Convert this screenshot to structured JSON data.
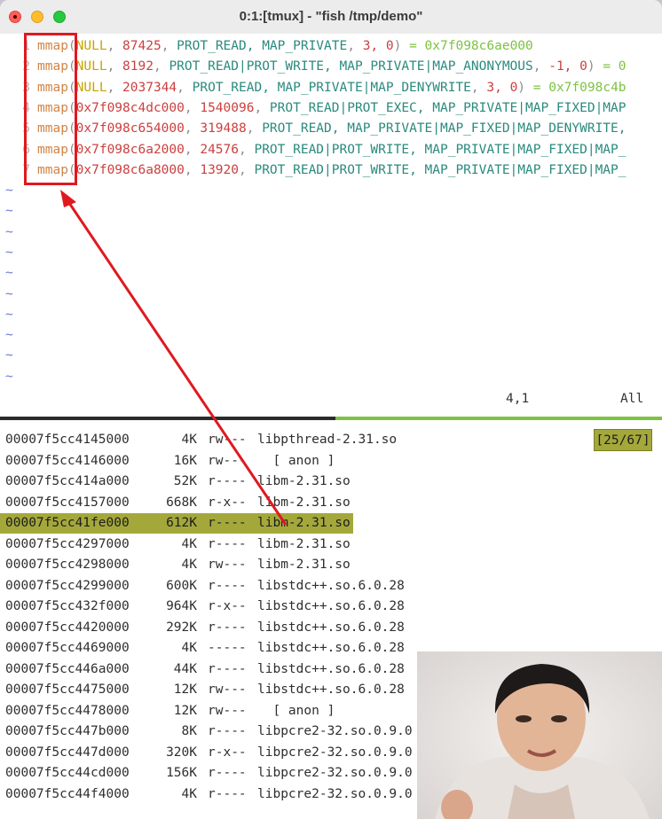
{
  "window": {
    "title": "0:1:[tmux] - \"fish /tmp/demo\""
  },
  "editor": {
    "lines": [
      {
        "num": "1",
        "arg1": "NULL",
        "arg2": "87425",
        "flags": "PROT_READ, MAP_PRIVATE",
        "tail": "3, 0",
        "result": "= 0x7f098c6ae000"
      },
      {
        "num": "2",
        "arg1": "NULL",
        "arg2": "8192",
        "flags": "PROT_READ|PROT_WRITE, MAP_PRIVATE|MAP_ANONYMOUS",
        "tail": "-1, 0",
        "result": "= 0"
      },
      {
        "num": "3",
        "arg1": "NULL",
        "arg2": "2037344",
        "flags": "PROT_READ, MAP_PRIVATE|MAP_DENYWRITE",
        "tail": "3, 0",
        "result": "= 0x7f098c4b"
      },
      {
        "num": "4",
        "arg1": "0x7f098c4dc000",
        "arg2": "1540096",
        "flags": "PROT_READ|PROT_EXEC, MAP_PRIVATE|MAP_FIXED|MAP",
        "tail": "",
        "result": ""
      },
      {
        "num": "5",
        "arg1": "0x7f098c654000",
        "arg2": "319488",
        "flags": "PROT_READ, MAP_PRIVATE|MAP_FIXED|MAP_DENYWRITE,",
        "tail": "",
        "result": ""
      },
      {
        "num": "6",
        "arg1": "0x7f098c6a2000",
        "arg2": "24576",
        "flags": "PROT_READ|PROT_WRITE, MAP_PRIVATE|MAP_FIXED|MAP_",
        "tail": "",
        "result": ""
      },
      {
        "num": "7",
        "arg1": "0x7f098c6a8000",
        "arg2": "13920",
        "flags": "PROT_READ|PROT_WRITE, MAP_PRIVATE|MAP_FIXED|MAP_",
        "tail": "",
        "result": ""
      }
    ],
    "fn_name": "mmap",
    "tilde": "~",
    "cursor_pos": "4,1",
    "scroll_pos": "All"
  },
  "pmap": {
    "position": "[25/67]",
    "rows": [
      {
        "addr": "00007f5cc4145000",
        "size": "4K",
        "perm": "rw---",
        "name": "libpthread-2.31.so"
      },
      {
        "addr": "00007f5cc4146000",
        "size": "16K",
        "perm": "rw---",
        "name": "  [ anon ]"
      },
      {
        "addr": "00007f5cc414a000",
        "size": "52K",
        "perm": "r----",
        "name": "libm-2.31.so"
      },
      {
        "addr": "00007f5cc4157000",
        "size": "668K",
        "perm": "r-x--",
        "name": "libm-2.31.so"
      },
      {
        "addr": "00007f5cc41fe000",
        "size": "612K",
        "perm": "r----",
        "name": "libm-2.31.so",
        "highlight": true
      },
      {
        "addr": "00007f5cc4297000",
        "size": "4K",
        "perm": "r----",
        "name": "libm-2.31.so"
      },
      {
        "addr": "00007f5cc4298000",
        "size": "4K",
        "perm": "rw---",
        "name": "libm-2.31.so"
      },
      {
        "addr": "00007f5cc4299000",
        "size": "600K",
        "perm": "r----",
        "name": "libstdc++.so.6.0.28"
      },
      {
        "addr": "00007f5cc432f000",
        "size": "964K",
        "perm": "r-x--",
        "name": "libstdc++.so.6.0.28"
      },
      {
        "addr": "00007f5cc4420000",
        "size": "292K",
        "perm": "r----",
        "name": "libstdc++.so.6.0.28"
      },
      {
        "addr": "00007f5cc4469000",
        "size": "4K",
        "perm": "-----",
        "name": "libstdc++.so.6.0.28"
      },
      {
        "addr": "00007f5cc446a000",
        "size": "44K",
        "perm": "r----",
        "name": "libstdc++.so.6.0.28"
      },
      {
        "addr": "00007f5cc4475000",
        "size": "12K",
        "perm": "rw---",
        "name": "libstdc++.so.6.0.28"
      },
      {
        "addr": "00007f5cc4478000",
        "size": "12K",
        "perm": "rw---",
        "name": "  [ anon ]"
      },
      {
        "addr": "00007f5cc447b000",
        "size": "8K",
        "perm": "r----",
        "name": "libpcre2-32.so.0.9.0"
      },
      {
        "addr": "00007f5cc447d000",
        "size": "320K",
        "perm": "r-x--",
        "name": "libpcre2-32.so.0.9.0"
      },
      {
        "addr": "00007f5cc44cd000",
        "size": "156K",
        "perm": "r----",
        "name": "libpcre2-32.so.0.9.0"
      },
      {
        "addr": "00007f5cc44f4000",
        "size": "4K",
        "perm": "r----",
        "name": "libpcre2-32.so.0.9.0"
      }
    ]
  },
  "colors": {
    "highlight": "#a4a83b",
    "annotation": "#e0191f",
    "status_green": "#7dc242"
  }
}
